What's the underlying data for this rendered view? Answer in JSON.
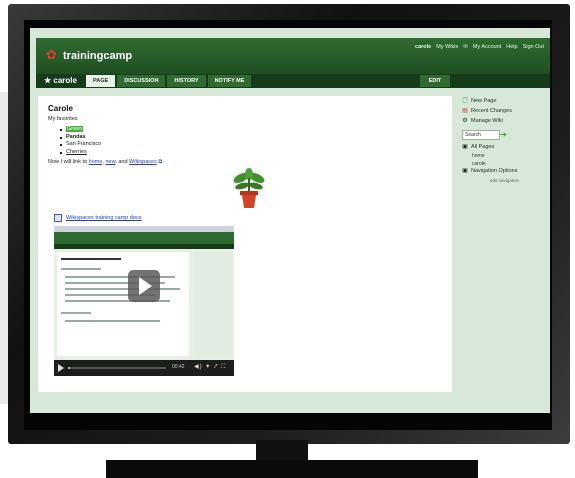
{
  "header": {
    "site_name": "trainingcamp",
    "user": "carole",
    "links": [
      "My Wikis",
      "My Account",
      "Help",
      "Sign Out"
    ]
  },
  "nav": {
    "workspace_user": "★ carole",
    "tabs": [
      "PAGE",
      "DISCUSSION",
      "HISTORY",
      "NOTIFY ME"
    ],
    "edit": "EDIT"
  },
  "page": {
    "title": "Carole",
    "intro": "My favorites",
    "favorites": [
      "Green",
      "Pandas",
      "San Francisco",
      "Cherries"
    ],
    "link_prefix": "Now I will link to ",
    "links": [
      "home",
      "new",
      "Wikispaces"
    ],
    "link_and": ", and ",
    "doc_link": "Wikispaces training camp docs"
  },
  "video": {
    "play_label": "PLAY",
    "time": "00:42",
    "progress": 0.02
  },
  "sidebar": {
    "new_page": "New Page",
    "recent_changes": "Recent Changes",
    "manage_wiki": "Manage Wiki",
    "search_value": "Search",
    "all_pages": "All Pages",
    "pages": [
      "home",
      "carole"
    ],
    "navigation_options": "Navigation Options",
    "edit_navigation": "edit navigation"
  },
  "colors": {
    "header": "#2e6b30",
    "navbar": "#163b18",
    "highlight": "#48b038",
    "link": "#2244bb"
  }
}
